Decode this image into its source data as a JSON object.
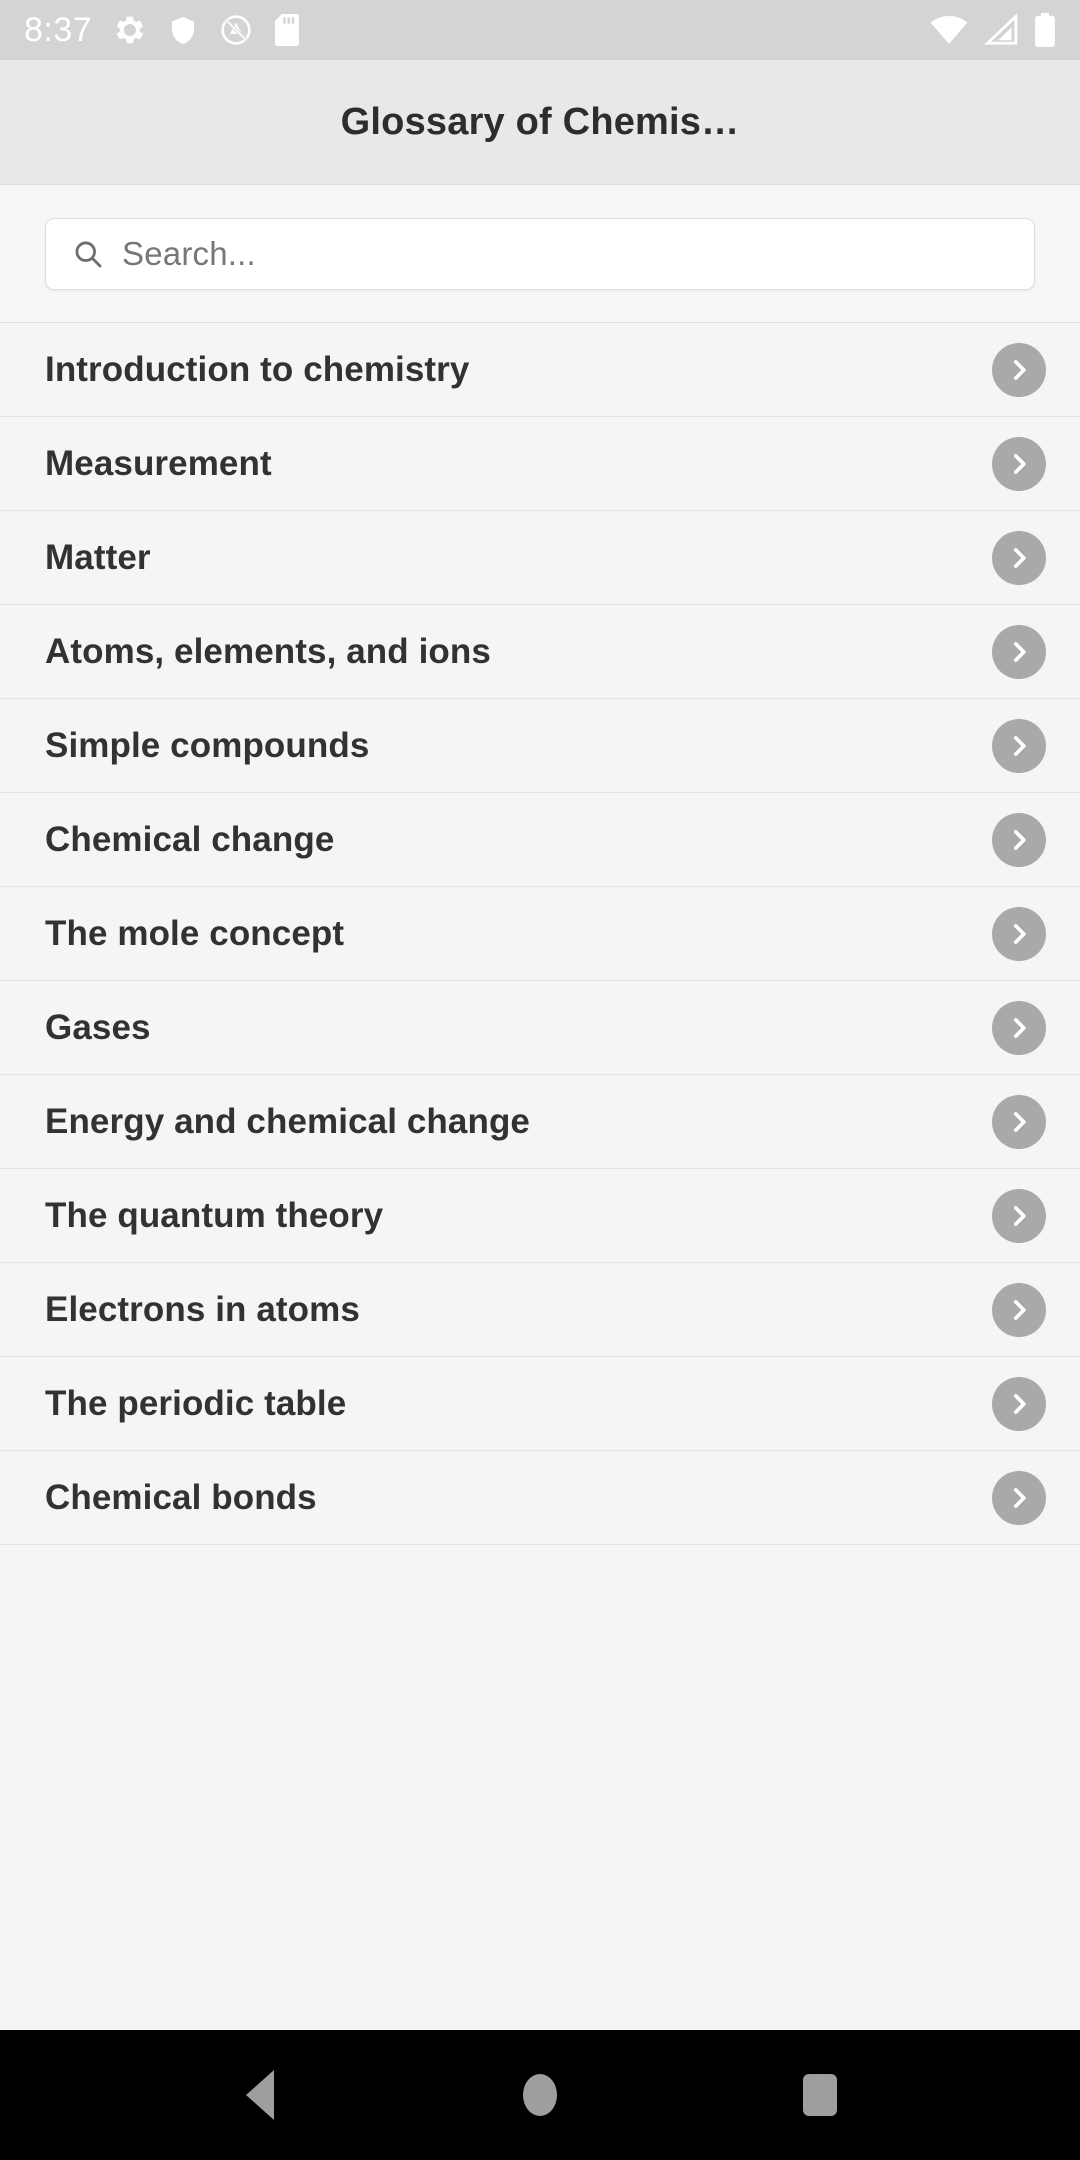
{
  "status_bar": {
    "time": "8:37",
    "left_icons": [
      "gear-icon",
      "shield-icon",
      "no-ads-circle-slash-icon",
      "sd-card-icon"
    ],
    "right_icons": [
      "wifi-icon",
      "cell-signal-icon",
      "battery-icon"
    ],
    "background_color": "#d4d4d4",
    "icon_color": "#ffffff"
  },
  "title_bar": {
    "title": "Glossary of Chemis…",
    "background_color": "#e8e8e8",
    "text_color": "#2d2d2d"
  },
  "search": {
    "placeholder": "Search...",
    "value": "",
    "icon": "search-icon"
  },
  "list": {
    "chevron_icon": "chevron-right-icon",
    "chevron_badge_color": "#a9a9a9",
    "items": [
      {
        "label": "Introduction to chemistry"
      },
      {
        "label": "Measurement"
      },
      {
        "label": "Matter"
      },
      {
        "label": "Atoms, elements, and ions"
      },
      {
        "label": "Simple compounds"
      },
      {
        "label": "Chemical change"
      },
      {
        "label": "The mole concept"
      },
      {
        "label": "Gases"
      },
      {
        "label": "Energy and chemical change"
      },
      {
        "label": "The quantum theory"
      },
      {
        "label": "Electrons in atoms"
      },
      {
        "label": "The periodic table"
      },
      {
        "label": "Chemical bonds"
      }
    ]
  },
  "nav_bar": {
    "background_color": "#000000",
    "buttons": [
      {
        "name": "back-button",
        "icon": "triangle-left-icon"
      },
      {
        "name": "home-button",
        "icon": "circle-icon"
      },
      {
        "name": "recents-button",
        "icon": "square-icon"
      }
    ]
  }
}
